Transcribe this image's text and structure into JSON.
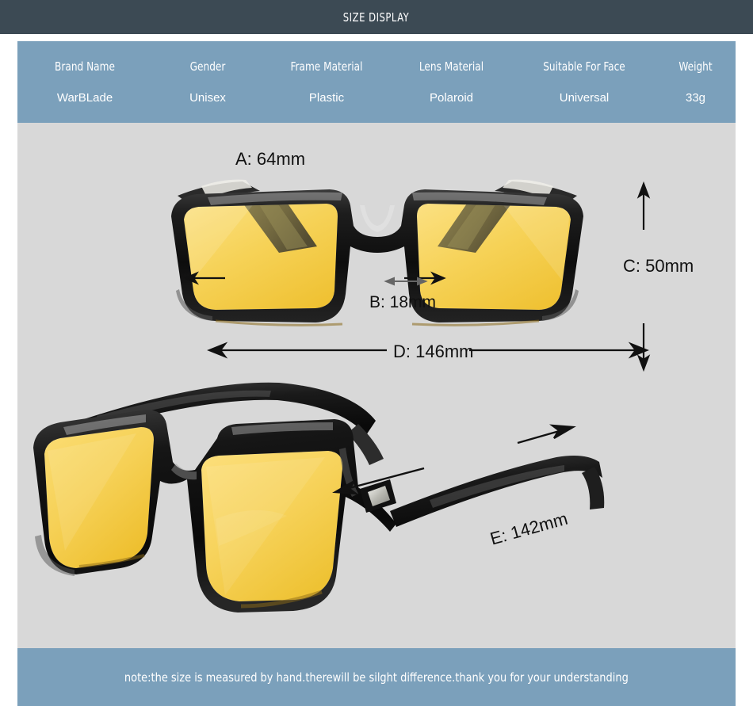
{
  "header": {
    "title": "SIZE DISPLAY"
  },
  "spec_table": {
    "headers": [
      "Brand Name",
      "Gender",
      "Frame Material",
      "Lens Material",
      "Suitable For Face",
      "Weight"
    ],
    "values": [
      "WarBLade",
      "Unisex",
      "Plastic",
      "Polaroid",
      "Universal",
      "33g"
    ]
  },
  "dimensions": {
    "a": "A: 64mm",
    "b": "B: 18mm",
    "c": "C: 50mm",
    "d": "D: 146mm",
    "e": "E: 142mm"
  },
  "footer": {
    "note": "note:the size is measured by hand.therewill be silght difference.thank you for your understanding"
  },
  "colors": {
    "header_bar": "#3c4a54",
    "table_bar": "#7ba0bb",
    "photo_background": "#d8d8d8",
    "lens": "#f6d25c",
    "frame": "#141414",
    "text_light": "#ffffff",
    "text_dark": "#111111"
  },
  "product": {
    "front_view_alt": "sunglasses-front-view",
    "angled_view_alt": "sunglasses-angled-view"
  }
}
